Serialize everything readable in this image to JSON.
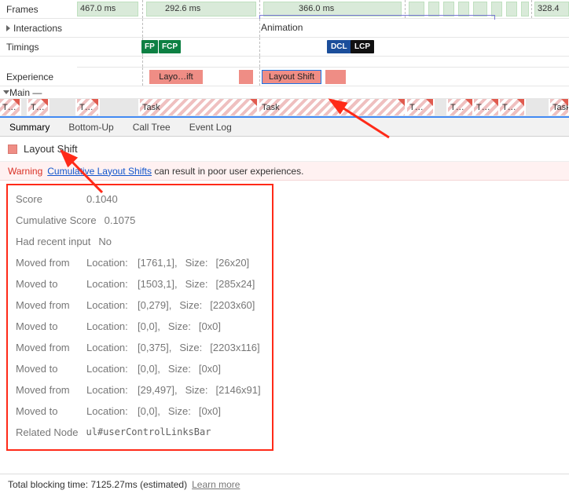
{
  "rows": {
    "frames": "Frames",
    "interactions": "Interactions",
    "timings": "Timings",
    "experience": "Experience",
    "main": "Main",
    "dash": "—"
  },
  "frame_times": {
    "f1": "467.0 ms",
    "f2": "292.6 ms",
    "f3": "366.0 ms",
    "f4": "328.4"
  },
  "interaction_anim": "Animation",
  "timing_badges": {
    "fp": "FP",
    "fcp": "FCP",
    "dcl": "DCL",
    "lcp": "LCP"
  },
  "experience": {
    "layo": "Layo…ift",
    "shift": "Layout Shift"
  },
  "tasks": {
    "short": "T…",
    "task": "Task"
  },
  "tabs": {
    "summary": "Summary",
    "bottom_up": "Bottom-Up",
    "call_tree": "Call Tree",
    "event_log": "Event Log"
  },
  "summary_title": "Layout Shift",
  "warning": {
    "label": "Warning",
    "link": "Cumulative Layout Shifts",
    "rest": "can result in poor user experiences."
  },
  "details": {
    "score_l": "Score",
    "score_v": "0.1040",
    "cum_l": "Cumulative Score",
    "cum_v": "0.1075",
    "recent_l": "Had recent input",
    "recent_v": "No",
    "loc_l": "Location:",
    "size_l": "Size:",
    "mf": "Moved from",
    "mt": "Moved to",
    "r1_from_loc": "[1761,1],",
    "r1_from_size": "[26x20]",
    "r1_to_loc": "[1503,1],",
    "r1_to_size": "[285x24]",
    "r2_from_loc": "[0,279],",
    "r2_from_size": "[2203x60]",
    "r2_to_loc": "[0,0],",
    "r2_to_size": "[0x0]",
    "r3_from_loc": "[0,375],",
    "r3_from_size": "[2203x116]",
    "r3_to_loc": "[0,0],",
    "r3_to_size": "[0x0]",
    "r4_from_loc": "[29,497],",
    "r4_from_size": "[2146x91]",
    "r4_to_loc": "[0,0],",
    "r4_to_size": "[0x0]",
    "related_l": "Related Node",
    "related_v": "ul#userControlLinksBar"
  },
  "footer": {
    "text": "Total blocking time: 7125.27ms (estimated)",
    "learn": "Learn more"
  }
}
